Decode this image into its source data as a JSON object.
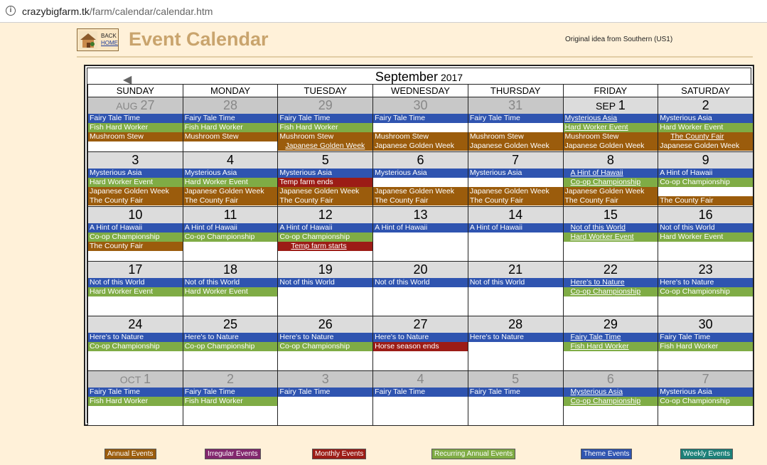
{
  "browser": {
    "url_host": "crazybigfarm.tk",
    "url_path": "/farm/calendar/calendar.htm"
  },
  "header": {
    "back_line1": "BACK",
    "back_line2": "HOME",
    "title": "Event Calendar",
    "credit": "Original idea from Southern (US1)"
  },
  "calendar": {
    "month": "September",
    "year": "2017",
    "weekdays": [
      "SUNDAY",
      "MONDAY",
      "TUESDAY",
      "WEDNESDAY",
      "THURSDAY",
      "FRIDAY",
      "SATURDAY"
    ],
    "weeks": [
      [
        {
          "mo": "AUG",
          "d": "27",
          "other": true,
          "ev": [
            [
              "Fairy Tale Time",
              "theme"
            ],
            [
              "Fish Hard Worker",
              "recur"
            ],
            [
              "Mushroom Stew",
              "annual"
            ]
          ]
        },
        {
          "d": "28",
          "other": true,
          "ev": [
            [
              "Fairy Tale Time",
              "theme"
            ],
            [
              "Fish Hard Worker",
              "recur"
            ],
            [
              "Mushroom Stew",
              "annual"
            ]
          ]
        },
        {
          "d": "29",
          "other": true,
          "ev": [
            [
              "Fairy Tale Time",
              "theme"
            ],
            [
              "Fish Hard Worker",
              "recur"
            ],
            [
              "Mushroom Stew",
              "annual"
            ],
            [
              "Japanese Golden Week",
              "annual",
              "u ind"
            ]
          ]
        },
        {
          "d": "30",
          "other": true,
          "ev": [
            [
              "Fairy Tale Time",
              "theme"
            ],
            [
              "",
              "blank"
            ],
            [
              "Mushroom Stew",
              "annual"
            ],
            [
              "Japanese Golden Week",
              "annual"
            ]
          ]
        },
        {
          "d": "31",
          "other": true,
          "ev": [
            [
              "Fairy Tale Time",
              "theme"
            ],
            [
              "",
              "blank"
            ],
            [
              "Mushroom Stew",
              "annual"
            ],
            [
              "Japanese Golden Week",
              "annual"
            ]
          ]
        },
        {
          "mo": "SEP",
          "d": "1",
          "ev": [
            [
              "Mysterious Asia",
              "theme",
              "u"
            ],
            [
              "Hard Worker Event",
              "recur",
              "u"
            ],
            [
              "Mushroom Stew",
              "annual"
            ],
            [
              "Japanese Golden Week",
              "annual"
            ]
          ]
        },
        {
          "d": "2",
          "ev": [
            [
              "Mysterious Asia",
              "theme"
            ],
            [
              "Hard Worker Event",
              "recur"
            ],
            [
              "The County Fair",
              "annual",
              "u hw"
            ],
            [
              "Japanese Golden Week",
              "annual"
            ]
          ]
        }
      ],
      [
        {
          "d": "3",
          "ev": [
            [
              "Mysterious Asia",
              "theme"
            ],
            [
              "Hard Worker Event",
              "recur"
            ],
            [
              "Japanese Golden Week",
              "annual"
            ],
            [
              "The County Fair",
              "annual"
            ]
          ]
        },
        {
          "d": "4",
          "ev": [
            [
              "Mysterious Asia",
              "theme"
            ],
            [
              "Hard Worker Event",
              "recur"
            ],
            [
              "Japanese Golden Week",
              "annual"
            ],
            [
              "The County Fair",
              "annual"
            ]
          ]
        },
        {
          "d": "5",
          "ev": [
            [
              "Mysterious Asia",
              "theme"
            ],
            [
              "Temp farm ends",
              "monthly"
            ],
            [
              "Japanese Golden Week",
              "annual"
            ],
            [
              "The County Fair",
              "annual"
            ]
          ]
        },
        {
          "d": "6",
          "ev": [
            [
              "Mysterious Asia",
              "theme"
            ],
            [
              "",
              "blank"
            ],
            [
              "Japanese Golden Week",
              "annual"
            ],
            [
              "The County Fair",
              "annual"
            ]
          ]
        },
        {
          "d": "7",
          "ev": [
            [
              "Mysterious Asia",
              "theme"
            ],
            [
              "",
              "blank"
            ],
            [
              "Japanese Golden Week",
              "annual"
            ],
            [
              "The County Fair",
              "annual"
            ]
          ]
        },
        {
          "d": "8",
          "ev": [
            [
              "A Hint of Hawaii",
              "theme",
              "u ind"
            ],
            [
              "Co-op Championship",
              "recur",
              "u ind"
            ],
            [
              "Japanese Golden Week",
              "annual"
            ],
            [
              "The County Fair",
              "annual"
            ]
          ]
        },
        {
          "d": "9",
          "ev": [
            [
              "A Hint of Hawaii",
              "theme"
            ],
            [
              "Co-op Championship",
              "recur"
            ],
            [
              "",
              "blank"
            ],
            [
              "The County Fair",
              "annual"
            ]
          ]
        }
      ],
      [
        {
          "d": "10",
          "ev": [
            [
              "A Hint of Hawaii",
              "theme"
            ],
            [
              "Co-op Championship",
              "recur"
            ],
            [
              "The County Fair",
              "annual"
            ]
          ]
        },
        {
          "d": "11",
          "ev": [
            [
              "A Hint of Hawaii",
              "theme"
            ],
            [
              "Co-op Championship",
              "recur"
            ]
          ]
        },
        {
          "d": "12",
          "ev": [
            [
              "A Hint of Hawaii",
              "theme"
            ],
            [
              "Co-op Championship",
              "recur"
            ],
            [
              "Temp farm starts",
              "monthly",
              "u ind2"
            ]
          ]
        },
        {
          "d": "13",
          "ev": [
            [
              "A Hint of Hawaii",
              "theme"
            ]
          ]
        },
        {
          "d": "14",
          "ev": [
            [
              "A Hint of Hawaii",
              "theme"
            ]
          ]
        },
        {
          "d": "15",
          "ev": [
            [
              "Not of this World",
              "theme",
              "u ind"
            ],
            [
              "Hard Worker Event",
              "recur",
              "u ind"
            ]
          ]
        },
        {
          "d": "16",
          "ev": [
            [
              "Not of this World",
              "theme"
            ],
            [
              "Hard Worker Event",
              "recur"
            ]
          ]
        }
      ],
      [
        {
          "d": "17",
          "ev": [
            [
              "Not of this World",
              "theme"
            ],
            [
              "Hard Worker Event",
              "recur"
            ]
          ]
        },
        {
          "d": "18",
          "ev": [
            [
              "Not of this World",
              "theme"
            ],
            [
              "Hard Worker Event",
              "recur"
            ]
          ]
        },
        {
          "d": "19",
          "ev": [
            [
              "Not of this World",
              "theme"
            ]
          ]
        },
        {
          "d": "20",
          "ev": [
            [
              "Not of this World",
              "theme"
            ]
          ]
        },
        {
          "d": "21",
          "ev": [
            [
              "Not of this World",
              "theme"
            ]
          ]
        },
        {
          "d": "22",
          "ev": [
            [
              "Here's to Nature",
              "theme",
              "u ind"
            ],
            [
              "Co-op Championship",
              "recur",
              "u ind"
            ]
          ]
        },
        {
          "d": "23",
          "ev": [
            [
              "Here's to Nature",
              "theme"
            ],
            [
              "Co-op Championship",
              "recur"
            ]
          ]
        }
      ],
      [
        {
          "d": "24",
          "ev": [
            [
              "Here's to Nature",
              "theme"
            ],
            [
              "Co-op Championship",
              "recur"
            ]
          ]
        },
        {
          "d": "25",
          "ev": [
            [
              "Here's to Nature",
              "theme"
            ],
            [
              "Co-op Championship",
              "recur"
            ]
          ]
        },
        {
          "d": "26",
          "ev": [
            [
              "Here's to Nature",
              "theme"
            ],
            [
              "Co-op Championship",
              "recur"
            ]
          ]
        },
        {
          "d": "27",
          "ev": [
            [
              "Here's to Nature",
              "theme"
            ],
            [
              "Horse season ends",
              "monthly"
            ]
          ]
        },
        {
          "d": "28",
          "ev": [
            [
              "Here's to Nature",
              "theme"
            ]
          ]
        },
        {
          "d": "29",
          "ev": [
            [
              "Fairy Tale Time",
              "theme",
              "u ind"
            ],
            [
              "Fish Hard Worker",
              "recur",
              "u ind"
            ]
          ]
        },
        {
          "d": "30",
          "ev": [
            [
              "Fairy Tale Time",
              "theme"
            ],
            [
              "Fish Hard Worker",
              "recur"
            ]
          ]
        }
      ],
      [
        {
          "mo": "OCT",
          "d": "1",
          "other": true,
          "ev": [
            [
              "Fairy Tale Time",
              "theme"
            ],
            [
              "Fish Hard Worker",
              "recur"
            ]
          ]
        },
        {
          "d": "2",
          "other": true,
          "ev": [
            [
              "Fairy Tale Time",
              "theme"
            ],
            [
              "Fish Hard Worker",
              "recur"
            ]
          ]
        },
        {
          "d": "3",
          "other": true,
          "ev": [
            [
              "Fairy Tale Time",
              "theme"
            ]
          ]
        },
        {
          "d": "4",
          "other": true,
          "ev": [
            [
              "Fairy Tale Time",
              "theme"
            ]
          ]
        },
        {
          "d": "5",
          "other": true,
          "ev": [
            [
              "Fairy Tale Time",
              "theme"
            ]
          ]
        },
        {
          "d": "6",
          "other": true,
          "ev": [
            [
              "Mysterious Asia",
              "theme",
              "u ind"
            ],
            [
              "Co-op Championship",
              "recur",
              "u ind"
            ]
          ]
        },
        {
          "d": "7",
          "other": true,
          "ev": [
            [
              "Mysterious Asia",
              "theme"
            ],
            [
              "Co-op Championship",
              "recur"
            ]
          ]
        }
      ]
    ]
  },
  "legend": [
    {
      "label": "Annual Events",
      "cls": "annual"
    },
    {
      "label": "Irregular Events",
      "cls": "irr"
    },
    {
      "label": "Monthly Events",
      "cls": "monthly"
    },
    {
      "label": "Recurring Annual Events",
      "cls": "recur"
    },
    {
      "label": "Theme Events",
      "cls": "theme"
    },
    {
      "label": "Weekly Events",
      "cls": "weekly"
    }
  ],
  "colors": {
    "theme": "#2f54b0",
    "recur": "#7fac45",
    "annual": "#9b5c0c",
    "monthly": "#9c1c16",
    "irregular": "#82266d",
    "weekly": "#1c8078",
    "page_bg": "#fff1d9",
    "title": "#c9a46d"
  }
}
